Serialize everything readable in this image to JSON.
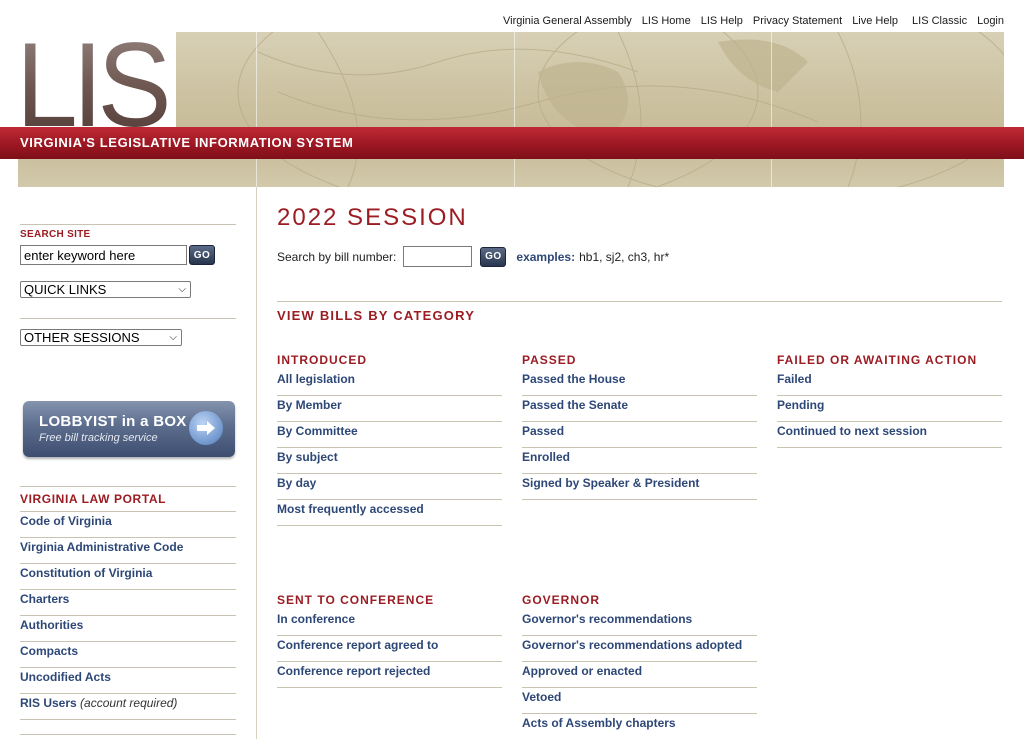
{
  "topnav": [
    "Virginia General Assembly",
    "LIS Home",
    "LIS Help",
    "Privacy Statement",
    "Live Help",
    "LIS Classic",
    "Login"
  ],
  "banner": {
    "logo_text": "LIS",
    "tagline": "VIRGINIA'S LEGISLATIVE INFORMATION SYSTEM"
  },
  "sidebar": {
    "search_label": "SEARCH SITE",
    "search_value": "enter keyword here",
    "go_label": "GO",
    "quick_links": "QUICK LINKS",
    "other_sessions": "OTHER SESSIONS",
    "lobbyist_title": "LOBBYIST in a BOX",
    "lobbyist_sub": "Free bill tracking service",
    "portal_title": "VIRGINIA LAW PORTAL",
    "portal_links": [
      {
        "label": "Code of Virginia",
        "note": ""
      },
      {
        "label": "Virginia Administrative Code",
        "note": ""
      },
      {
        "label": "Constitution of Virginia",
        "note": ""
      },
      {
        "label": "Charters",
        "note": ""
      },
      {
        "label": "Authorities",
        "note": ""
      },
      {
        "label": "Compacts",
        "note": ""
      },
      {
        "label": "Uncodified Acts",
        "note": ""
      },
      {
        "label": "RIS Users",
        "note": "(account required)"
      }
    ]
  },
  "main": {
    "title": "2022 SESSION",
    "bill_search_label": "Search by bill number:",
    "bill_search_value": "",
    "go_label": "GO",
    "examples_label": "examples:",
    "examples_text": "hb1, sj2, ch3, hr*",
    "category_heading": "VIEW BILLS BY CATEGORY",
    "categories": [
      {
        "title": "INTRODUCED",
        "links": [
          "All legislation",
          "By Member",
          "By Committee",
          "By subject",
          "By day",
          "Most frequently accessed"
        ]
      },
      {
        "title": "PASSED",
        "links": [
          "Passed the House",
          "Passed the Senate",
          "Passed",
          "Enrolled",
          "Signed by Speaker & President"
        ]
      },
      {
        "title": "FAILED OR AWAITING ACTION",
        "links": [
          "Failed",
          "Pending",
          "Continued to next session"
        ]
      },
      {
        "title": "SENT TO CONFERENCE",
        "links": [
          "In conference",
          "Conference report agreed to",
          "Conference report rejected"
        ]
      },
      {
        "title": "GOVERNOR",
        "links": [
          "Governor's recommendations",
          "Governor's recommendations adopted",
          "Approved or enacted",
          "Vetoed",
          "Acts of Assembly chapters"
        ]
      }
    ]
  },
  "colors": {
    "accent_red": "#9b1c23",
    "link_blue": "#2d4777",
    "banner_red": "#9c1722"
  }
}
